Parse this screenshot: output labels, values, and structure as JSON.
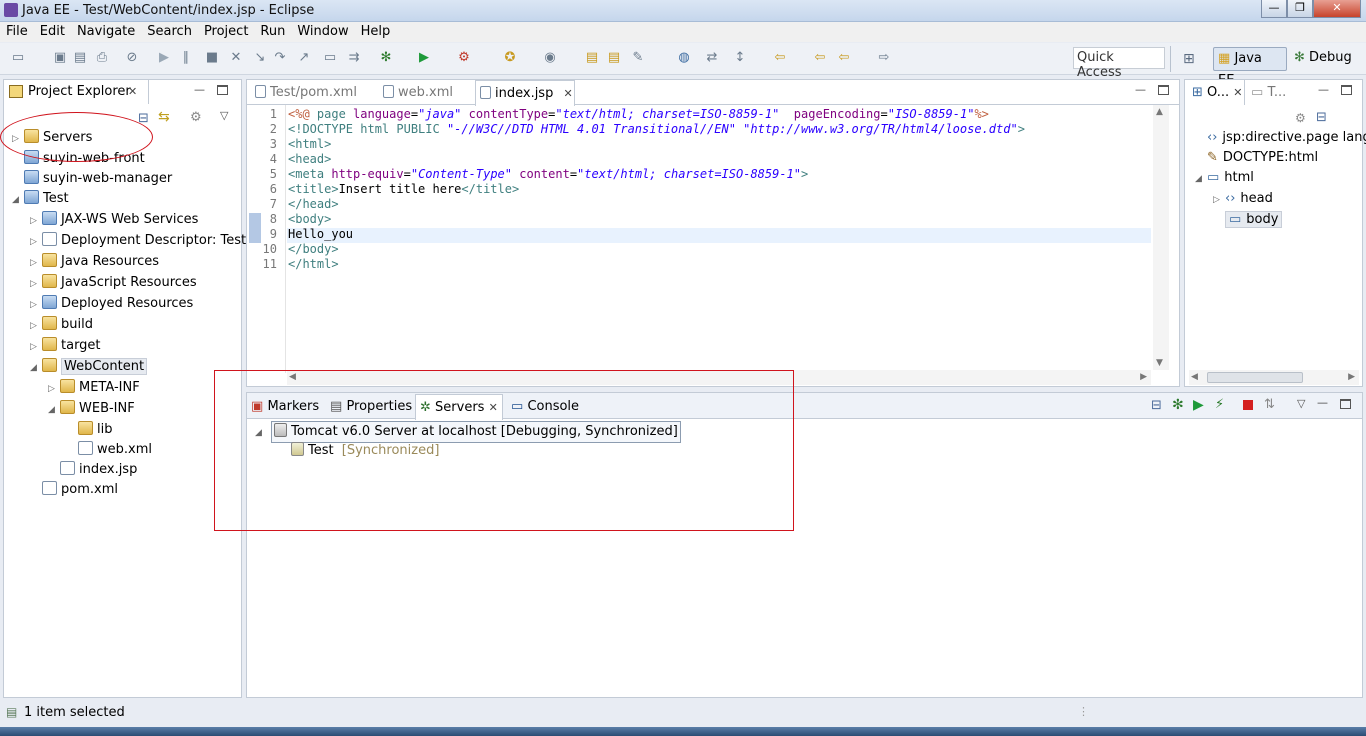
{
  "window": {
    "title": "Java EE - Test/WebContent/index.jsp - Eclipse",
    "min": "—",
    "max": "❐",
    "close": "✕"
  },
  "menu": [
    "File",
    "Edit",
    "Navigate",
    "Search",
    "Project",
    "Run",
    "Window",
    "Help"
  ],
  "toolbar": {
    "quick_access_placeholder": "Quick Access",
    "perspectives": [
      "Java EE",
      "Debug"
    ]
  },
  "project_explorer": {
    "title": "Project Explorer",
    "items": [
      {
        "label": "Servers",
        "indent": 0,
        "arrow": "▷",
        "icon": "folder"
      },
      {
        "label": "suyin-web-front",
        "indent": 0,
        "arrow": "",
        "icon": "proj"
      },
      {
        "label": "suyin-web-manager",
        "indent": 0,
        "arrow": "",
        "icon": "proj"
      },
      {
        "label": "Test",
        "indent": 0,
        "arrow": "◢",
        "icon": "proj"
      },
      {
        "label": "JAX-WS Web Services",
        "indent": 1,
        "arrow": "▷",
        "icon": "ws"
      },
      {
        "label": "Deployment Descriptor: Test",
        "indent": 1,
        "arrow": "▷",
        "icon": "dd"
      },
      {
        "label": "Java Resources",
        "indent": 1,
        "arrow": "▷",
        "icon": "jr"
      },
      {
        "label": "JavaScript Resources",
        "indent": 1,
        "arrow": "▷",
        "icon": "js"
      },
      {
        "label": "Deployed Resources",
        "indent": 1,
        "arrow": "▷",
        "icon": "dr"
      },
      {
        "label": "build",
        "indent": 1,
        "arrow": "▷",
        "icon": "folder"
      },
      {
        "label": "target",
        "indent": 1,
        "arrow": "▷",
        "icon": "folder"
      },
      {
        "label": "WebContent",
        "indent": 1,
        "arrow": "◢",
        "icon": "folder"
      },
      {
        "label": "META-INF",
        "indent": 2,
        "arrow": "▷",
        "icon": "folder"
      },
      {
        "label": "WEB-INF",
        "indent": 2,
        "arrow": "◢",
        "icon": "folder"
      },
      {
        "label": "lib",
        "indent": 3,
        "arrow": "",
        "icon": "folder"
      },
      {
        "label": "web.xml",
        "indent": 3,
        "arrow": "",
        "icon": "xml"
      },
      {
        "label": "index.jsp",
        "indent": 2,
        "arrow": "",
        "icon": "file"
      },
      {
        "label": "pom.xml",
        "indent": 1,
        "arrow": "",
        "icon": "file"
      }
    ]
  },
  "editor": {
    "tabs": [
      "Test/pom.xml",
      "web.xml",
      "index.jsp"
    ],
    "active_tab": "index.jsp",
    "line_numbers": [
      "1",
      "2",
      "3",
      "4",
      "5",
      "6",
      "7",
      "8",
      "9",
      "10",
      "11"
    ],
    "lines": [
      [
        [
          "dir",
          "<%@ "
        ],
        [
          "tag",
          "page "
        ],
        [
          "attr",
          "language"
        ],
        [
          "plain",
          "="
        ],
        [
          "str",
          "\"java\""
        ],
        [
          "plain",
          " "
        ],
        [
          "attr",
          "contentType"
        ],
        [
          "plain",
          "="
        ],
        [
          "str",
          "\"text/html; charset=ISO-8859-1\""
        ],
        [
          "plain",
          "  "
        ],
        [
          "attr",
          "pageEncoding"
        ],
        [
          "plain",
          "="
        ],
        [
          "str",
          "\"ISO-8859-1\""
        ],
        [
          "dir",
          "%>"
        ]
      ],
      [
        [
          "tag",
          "<!DOCTYPE html PUBLIC "
        ],
        [
          "str",
          "\"-//W3C//DTD HTML 4.01 Transitional//EN\""
        ],
        [
          "tag",
          " "
        ],
        [
          "str",
          "\"http://www.w3.org/TR/html4/loose.dtd\""
        ],
        [
          "tag",
          ">"
        ]
      ],
      [
        [
          "tag",
          "<html>"
        ]
      ],
      [
        [
          "tag",
          "<head>"
        ]
      ],
      [
        [
          "tag",
          "<meta "
        ],
        [
          "attr",
          "http-equiv"
        ],
        [
          "plain",
          "="
        ],
        [
          "str",
          "\"Content-Type\""
        ],
        [
          "plain",
          " "
        ],
        [
          "attr",
          "content"
        ],
        [
          "plain",
          "="
        ],
        [
          "str",
          "\"text/html; charset=ISO-8859-1\""
        ],
        [
          "tag",
          ">"
        ]
      ],
      [
        [
          "tag",
          "<title>"
        ],
        [
          "plain",
          "Insert title here"
        ],
        [
          "tag",
          "</title>"
        ]
      ],
      [
        [
          "tag",
          "</head>"
        ]
      ],
      [
        [
          "tag",
          "<body>"
        ]
      ],
      [
        [
          "plain",
          "Hello_you"
        ]
      ],
      [
        [
          "tag",
          "</body>"
        ]
      ],
      [
        [
          "tag",
          "</html>"
        ]
      ]
    ]
  },
  "outline": {
    "tabs": [
      "O...",
      "T..."
    ],
    "items": [
      {
        "label": "jsp:directive.page lang",
        "indent": 0
      },
      {
        "label": "DOCTYPE:html",
        "indent": 0
      },
      {
        "label": "html",
        "indent": 0
      },
      {
        "label": "head",
        "indent": 1
      },
      {
        "label": "body",
        "indent": 1
      }
    ]
  },
  "bottom": {
    "tabs": [
      "Markers",
      "Properties",
      "Servers",
      "Console"
    ],
    "active_tab": "Servers",
    "server": "Tomcat v6.0 Server at localhost  [Debugging, Synchronized]",
    "module": "Test",
    "module_state": "[Synchronized]"
  },
  "status": {
    "text": "1 item selected"
  },
  "colors": {
    "annotation": "#d0141d",
    "highlight_line": "#e8f2fe"
  }
}
